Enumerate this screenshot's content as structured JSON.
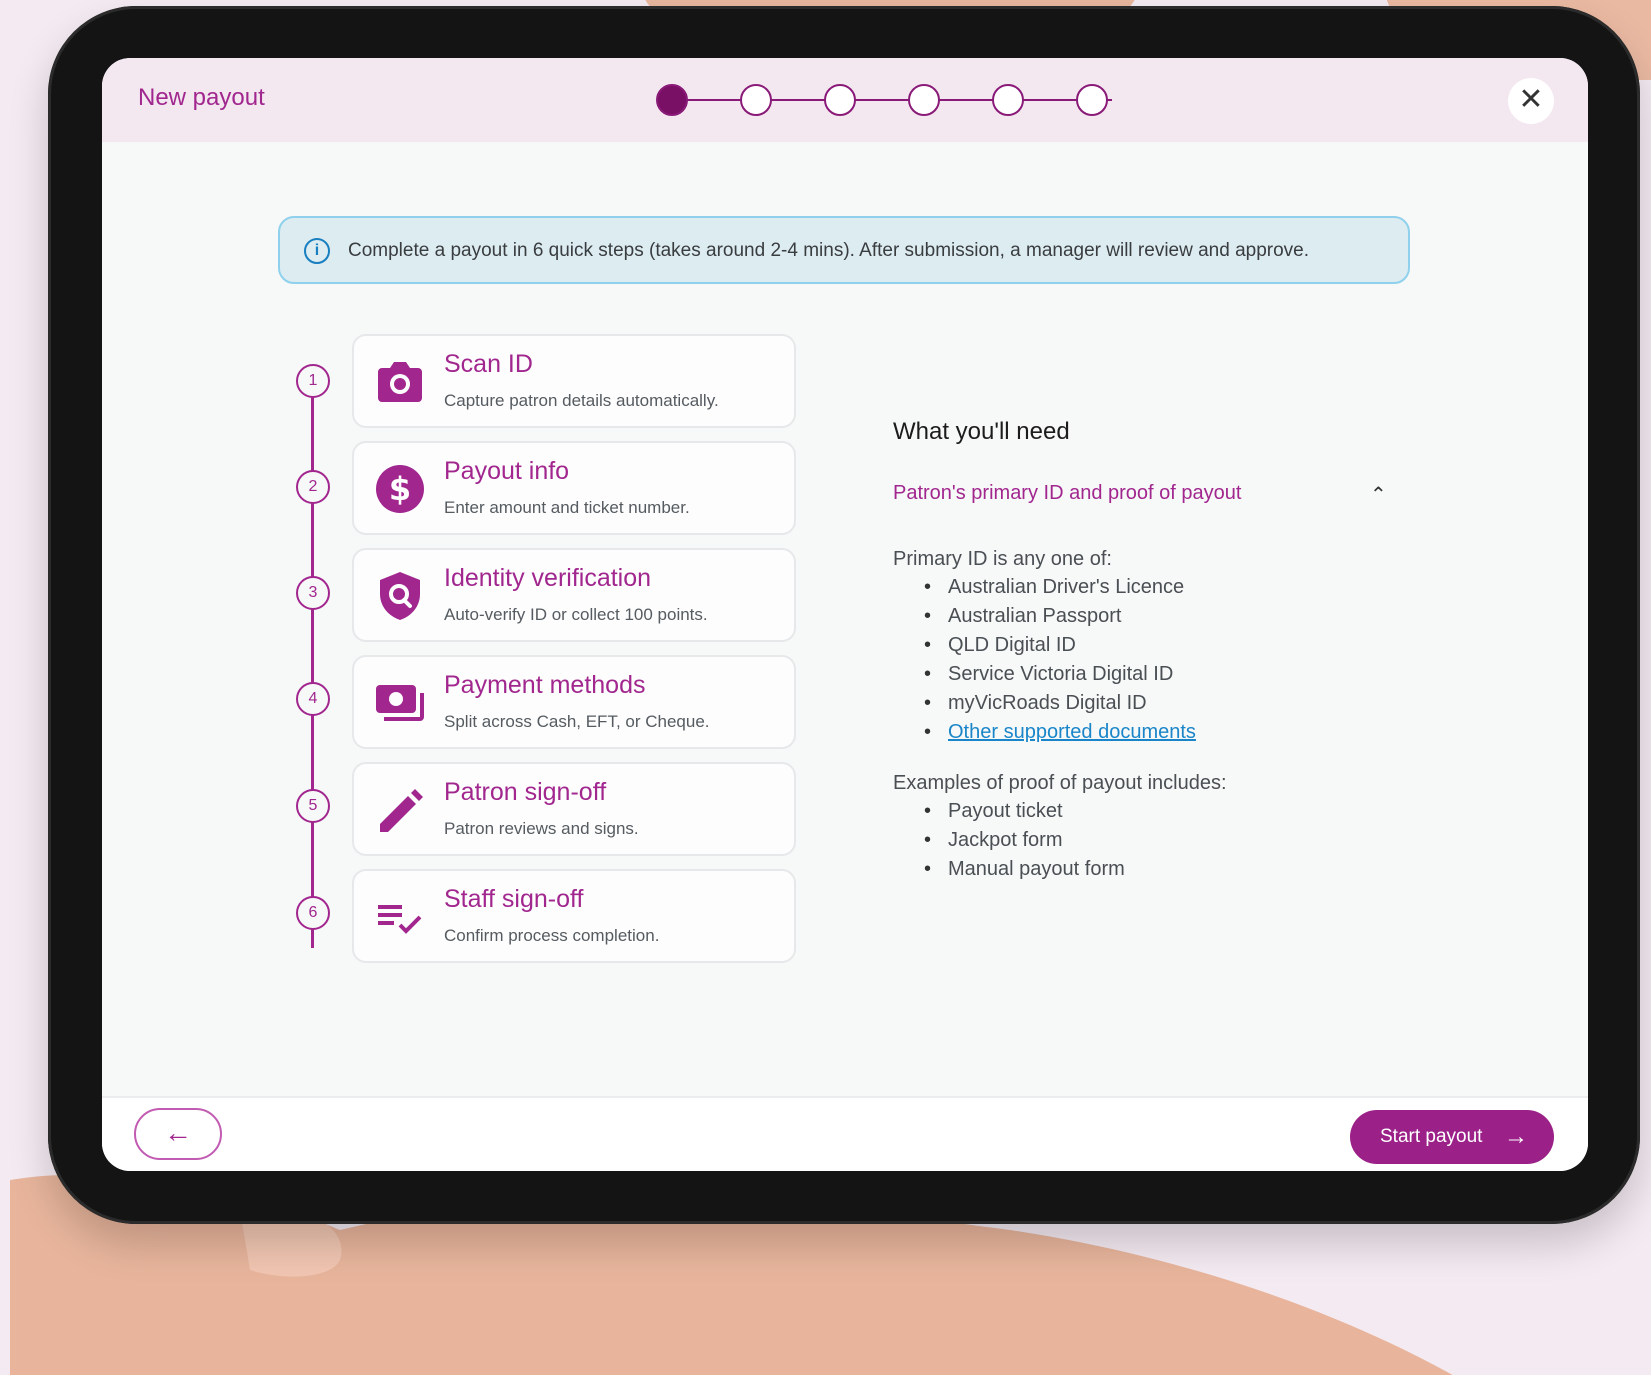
{
  "header": {
    "title": "New payout",
    "close_label": "✕"
  },
  "stepper": {
    "total_steps": 6,
    "current_step": 1
  },
  "banner": {
    "icon": "info-icon",
    "text": "Complete a payout in 6 quick steps (takes around 2-4 mins). After submission, a manager will review and approve."
  },
  "steps": [
    {
      "number": "1",
      "icon": "camera-icon",
      "title": "Scan ID",
      "subtitle": "Capture patron details automatically."
    },
    {
      "number": "2",
      "icon": "dollar-icon",
      "title": "Payout info",
      "subtitle": "Enter amount and ticket number."
    },
    {
      "number": "3",
      "icon": "shield-search-icon",
      "title": "Identity verification",
      "subtitle": "Auto-verify ID or collect 100 points."
    },
    {
      "number": "4",
      "icon": "money-icon",
      "title": "Payment methods",
      "subtitle": "Split across Cash, EFT, or Cheque."
    },
    {
      "number": "5",
      "icon": "pencil-icon",
      "title": "Patron sign-off",
      "subtitle": "Patron reviews and signs."
    },
    {
      "number": "6",
      "icon": "checklist-icon",
      "title": "Staff sign-off",
      "subtitle": "Confirm process completion."
    }
  ],
  "requirements": {
    "title": "What you'll need",
    "accordion_label": "Patron's primary ID and proof of payout",
    "primary_id_heading": "Primary ID is any one of:",
    "primary_ids": [
      "Australian Driver's Licence",
      "Australian Passport",
      "QLD Digital ID",
      "Service Victoria Digital ID",
      "myVicRoads Digital ID"
    ],
    "other_docs_link": "Other supported documents",
    "proof_heading": "Examples of proof of payout includes:",
    "proofs": [
      "Payout ticket",
      "Jackpot form",
      "Manual payout form"
    ]
  },
  "footer": {
    "back_label": "←",
    "start_label": "Start payout",
    "start_arrow": "→"
  },
  "colors": {
    "brand": "#a1278f",
    "brand_dark": "#7a0f66",
    "info_border": "#8fd1ec",
    "link": "#1a86c9"
  }
}
